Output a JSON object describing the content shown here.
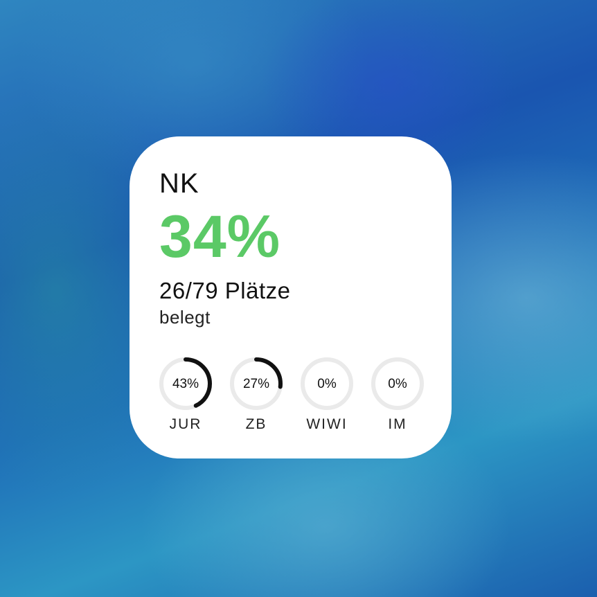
{
  "widget": {
    "title": "NK",
    "occupancy_percent": "34%",
    "places": "26/79 Plätze",
    "status": "belegt",
    "accent_color": "#5bc966"
  },
  "sections": [
    {
      "label": "JUR",
      "value_text": "43%",
      "fraction": 0.43
    },
    {
      "label": "ZB",
      "value_text": "27%",
      "fraction": 0.27
    },
    {
      "label": "WIWI",
      "value_text": "0%",
      "fraction": 0.0
    },
    {
      "label": "IM",
      "value_text": "0%",
      "fraction": 0.0
    }
  ]
}
